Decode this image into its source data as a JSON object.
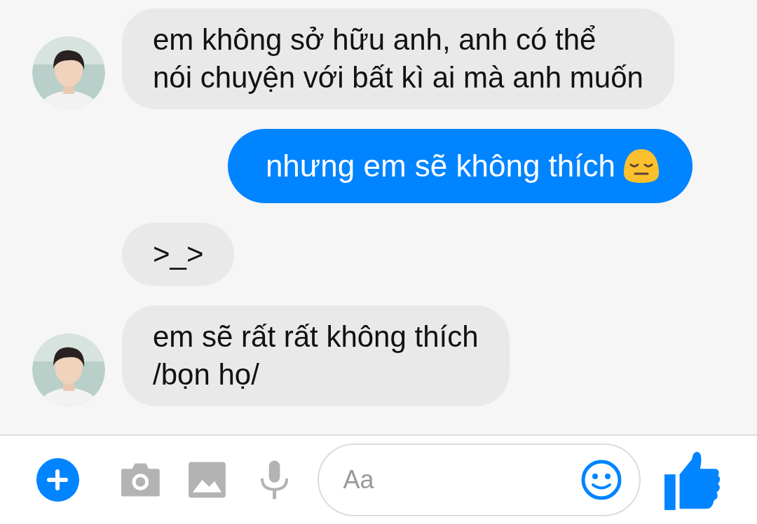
{
  "messages": [
    {
      "kind": "incoming",
      "avatar": true,
      "lines": [
        "em không sở hữu anh, anh có thể",
        "nói chuyện với bất kì ai mà anh muốn"
      ]
    },
    {
      "kind": "outgoing",
      "lines": [
        "nhưng em sẽ không thích"
      ],
      "emoji": true
    },
    {
      "kind": "incoming",
      "avatar": false,
      "lines": [
        ">_>"
      ]
    },
    {
      "kind": "incoming",
      "avatar": true,
      "lines": [
        "em sẽ rất rất không thích",
        "/bọn họ/"
      ]
    }
  ],
  "composer": {
    "placeholder": "Aa"
  }
}
